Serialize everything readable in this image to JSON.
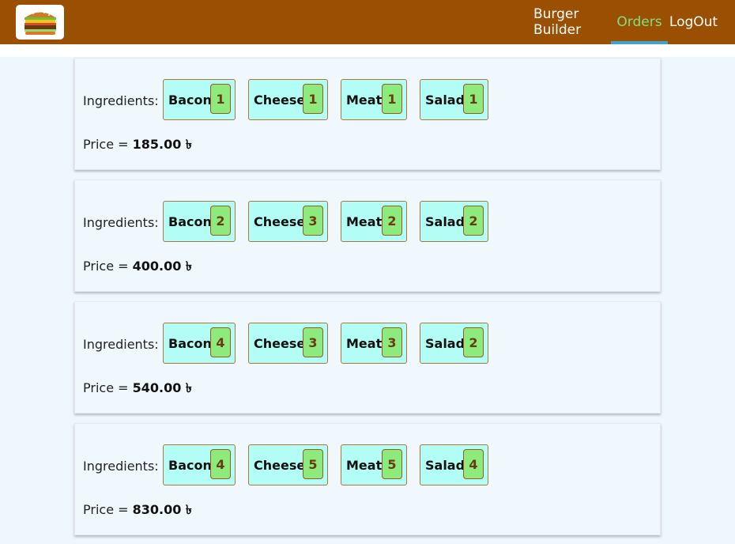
{
  "nav": {
    "items": [
      {
        "label": "Burger Builder",
        "active": false
      },
      {
        "label": "Orders",
        "active": true
      },
      {
        "label": "LogOut",
        "active": false
      }
    ]
  },
  "colors": {
    "header": "#9b4f03",
    "active_link": "#7fe07f",
    "active_underline": "#40a4c8",
    "chip_bg": "#b2fdf5",
    "count_bg": "#8ceb7c"
  },
  "orders": [
    {
      "ingredients_label": "Ingredients:",
      "ingredients": [
        {
          "name": "Bacon",
          "count": "1"
        },
        {
          "name": "Cheese",
          "count": "1"
        },
        {
          "name": "Meat",
          "count": "1"
        },
        {
          "name": "Salad",
          "count": "1"
        }
      ],
      "price_label": "Price = ",
      "price": "185.00 ৳"
    },
    {
      "ingredients_label": "Ingredients:",
      "ingredients": [
        {
          "name": "Bacon",
          "count": "2"
        },
        {
          "name": "Cheese",
          "count": "3"
        },
        {
          "name": "Meat",
          "count": "2"
        },
        {
          "name": "Salad",
          "count": "2"
        }
      ],
      "price_label": "Price = ",
      "price": "400.00 ৳"
    },
    {
      "ingredients_label": "Ingredients:",
      "ingredients": [
        {
          "name": "Bacon",
          "count": "4"
        },
        {
          "name": "Cheese",
          "count": "3"
        },
        {
          "name": "Meat",
          "count": "3"
        },
        {
          "name": "Salad",
          "count": "2"
        }
      ],
      "price_label": "Price = ",
      "price": "540.00 ৳"
    },
    {
      "ingredients_label": "Ingredients:",
      "ingredients": [
        {
          "name": "Bacon",
          "count": "4"
        },
        {
          "name": "Cheese",
          "count": "5"
        },
        {
          "name": "Meat",
          "count": "5"
        },
        {
          "name": "Salad",
          "count": "4"
        }
      ],
      "price_label": "Price = ",
      "price": "830.00 ৳"
    }
  ]
}
